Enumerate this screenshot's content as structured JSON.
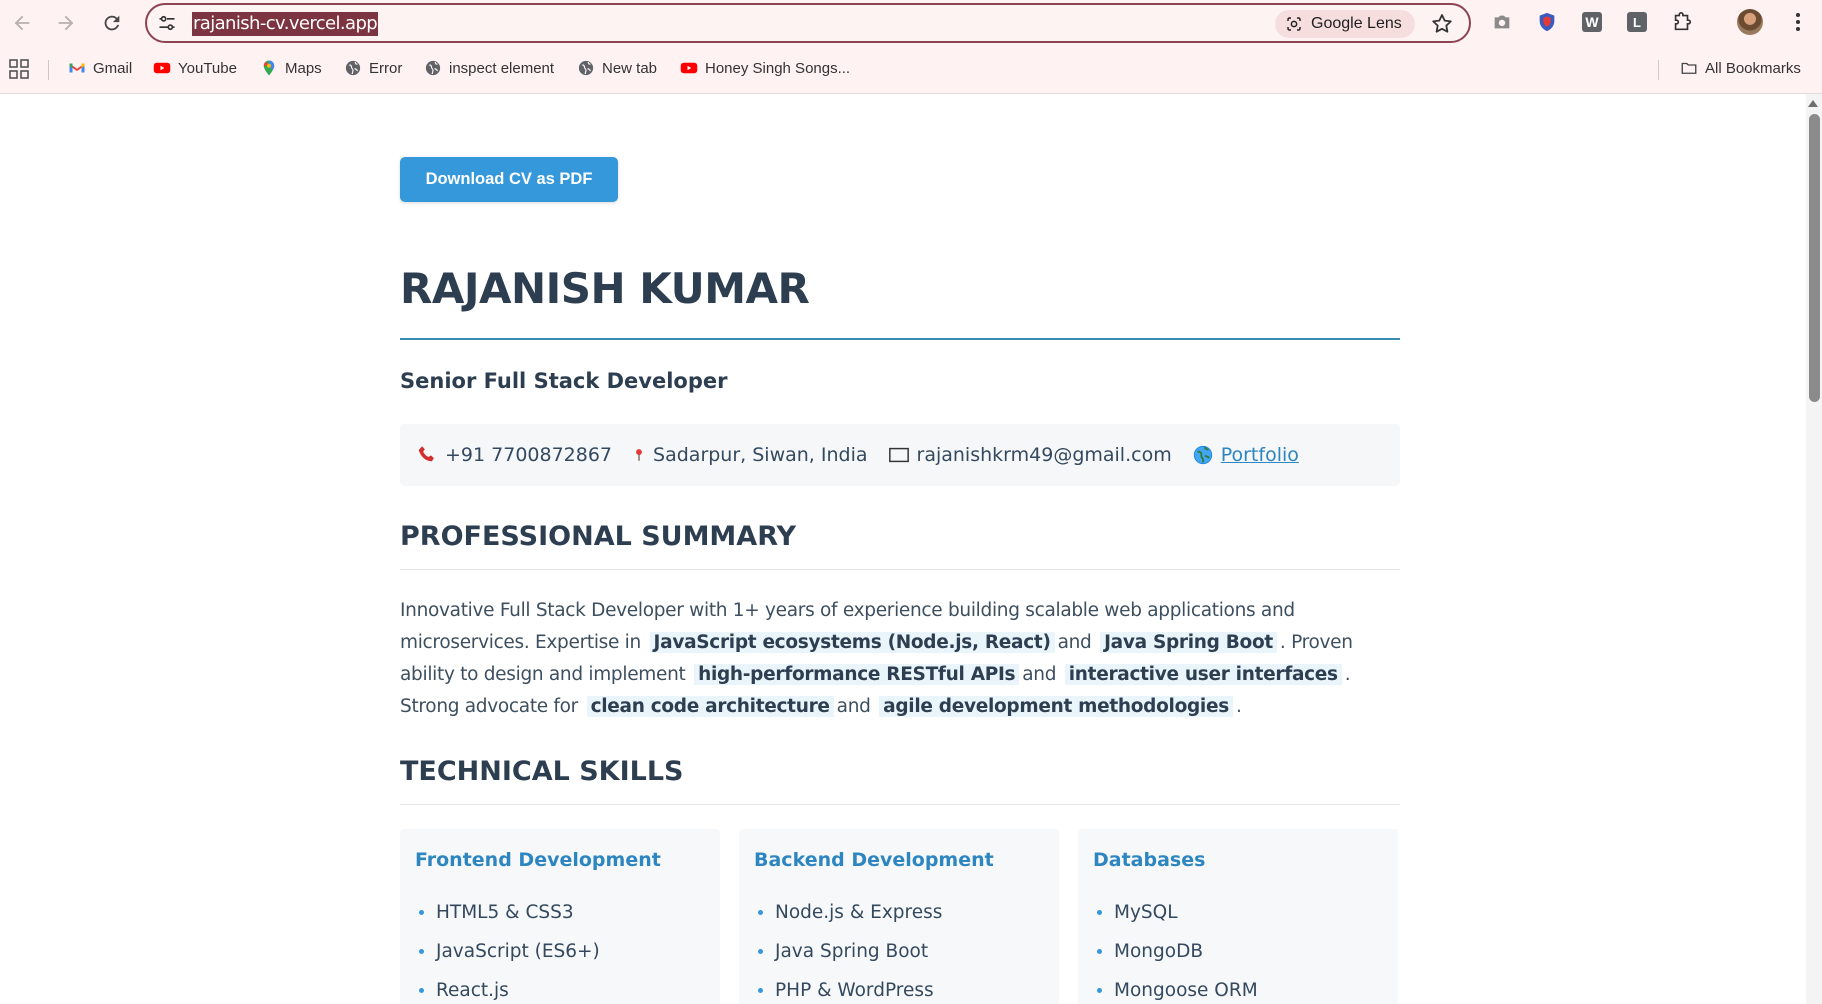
{
  "browser": {
    "url": "rajanish-cv.vercel.app",
    "lens_label": "Google Lens",
    "bookmarks": [
      {
        "label": "Gmail",
        "icon": "gmail-icon"
      },
      {
        "label": "YouTube",
        "icon": "youtube-icon"
      },
      {
        "label": "Maps",
        "icon": "maps-icon"
      },
      {
        "label": "Error",
        "icon": "globe-icon"
      },
      {
        "label": "inspect element",
        "icon": "globe-icon"
      },
      {
        "label": "New tab",
        "icon": "globe-icon"
      },
      {
        "label": "Honey Singh Songs...",
        "icon": "youtube-icon"
      }
    ],
    "all_bookmarks_label": "All Bookmarks",
    "extensions": {
      "w_label": "W",
      "l_label": "L"
    }
  },
  "cv": {
    "download_label": "Download CV as PDF",
    "name": "RAJANISH KUMAR",
    "role": "Senior Full Stack Developer",
    "contact": {
      "phone": "+91 7700872867",
      "location": "Sadarpur, Siwan, India",
      "email": "rajanishkrm49@gmail.com",
      "portfolio": "Portfolio"
    },
    "summary": {
      "title": "PROFESSIONAL SUMMARY",
      "t1": "Innovative Full Stack Developer with 1+ years of experience building scalable web applications and microservices. Expertise in",
      "h1": "JavaScript ecosystems (Node.js, React)",
      "t2": "and",
      "h2": "Java Spring Boot",
      "t3": ". Proven ability to design and implement",
      "h3": "high-performance RESTful APIs",
      "t4": "and",
      "h4": "interactive user interfaces",
      "t5": ". Strong advocate for",
      "h5": "clean code architecture",
      "t6": "and",
      "h6": "agile development methodologies",
      "t7": "."
    },
    "skills": {
      "title": "TECHNICAL SKILLS",
      "groups": [
        {
          "title": "Frontend Development",
          "items": [
            "HTML5 & CSS3",
            "JavaScript (ES6+)",
            "React.js"
          ]
        },
        {
          "title": "Backend Development",
          "items": [
            "Node.js & Express",
            "Java Spring Boot",
            "PHP & WordPress"
          ]
        },
        {
          "title": "Databases",
          "items": [
            "MySQL",
            "MongoDB",
            "Mongoose ORM"
          ]
        }
      ]
    }
  },
  "colors": {
    "accent": "#3498db",
    "heading": "#2c3e50",
    "chrome_bg": "#fef2f2",
    "url_highlight": "#7c3441"
  }
}
